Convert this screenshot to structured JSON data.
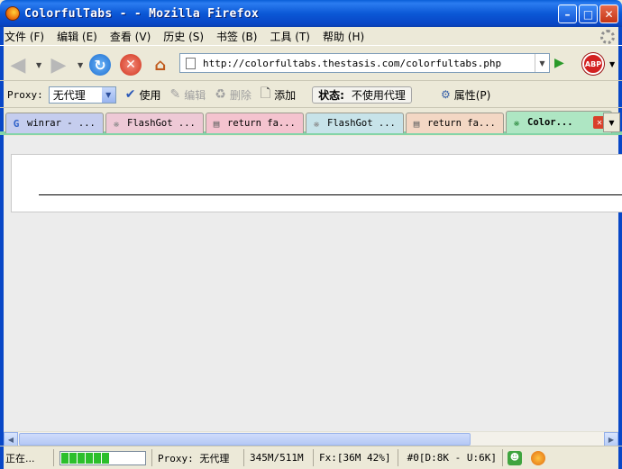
{
  "window": {
    "title": "ColorfulTabs - - Mozilla Firefox"
  },
  "menu": [
    "文件 (F)",
    "编辑 (E)",
    "查看 (V)",
    "历史 (S)",
    "书签 (B)",
    "工具 (T)",
    "帮助 (H)"
  ],
  "nav": {
    "url": "http://colorfultabs.thestasis.com/colorfultabs.php"
  },
  "proxybar": {
    "label": "Proxy:",
    "selected": "无代理",
    "use": "使用",
    "edit": "编辑",
    "delete": "删除",
    "add": "添加",
    "status_label": "状态:",
    "status_value": "不使用代理",
    "properties": "属性(P)"
  },
  "tabs": [
    {
      "label": "winrar - ...",
      "icon": "google-icon",
      "color": "#c5cdee"
    },
    {
      "label": "FlashGot ...",
      "icon": "flashgot-icon",
      "color": "#eec9d6"
    },
    {
      "label": "return fa...",
      "icon": "page-icon",
      "color": "#f4c3cf"
    },
    {
      "label": "FlashGot ...",
      "icon": "flashgot-icon",
      "color": "#c7e3e9"
    },
    {
      "label": "return fa...",
      "icon": "page-icon",
      "color": "#f3d7c4"
    },
    {
      "label": "Color...",
      "icon": "colorfultabs-icon",
      "color": "#aee6c3",
      "active": true
    }
  ],
  "statusbar": {
    "text": "正在...",
    "progress_fraction": 0.6,
    "proxy": "Proxy: 无代理",
    "memory": "345M/511M",
    "fx": "Fx:[36M 42%]",
    "cache": "#0[D:8K - U:6K]"
  }
}
